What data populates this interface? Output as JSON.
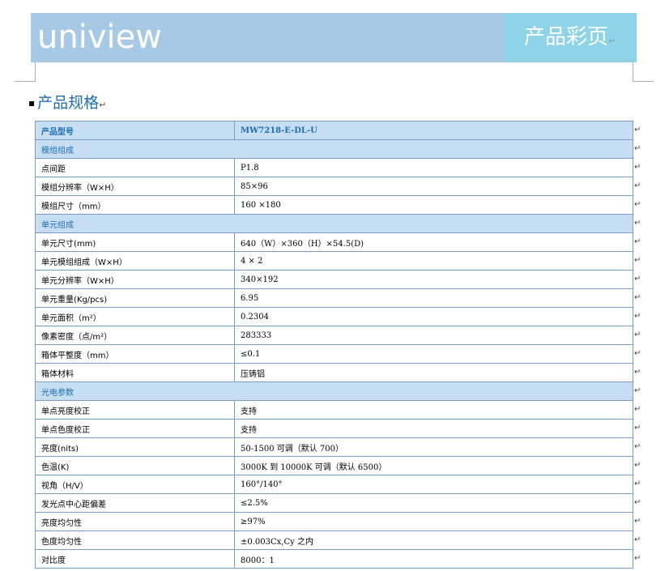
{
  "header": {
    "logo_text": "uniview",
    "brand_title": "产品彩页",
    "colors": {
      "band": "#a7c9e6",
      "band_right": "#8fd4e6",
      "accent": "#1f6fb0"
    }
  },
  "section": {
    "bullet": "▪",
    "title": "产品规格"
  },
  "paragraph_mark": "↵",
  "cell_end_mark": "↵",
  "table": {
    "rows": [
      {
        "type": "head",
        "label": "产品型号",
        "value": "MW7218-E-DL-U"
      },
      {
        "type": "section",
        "label": "模组组成"
      },
      {
        "type": "row",
        "label": "点间距",
        "value": "P1.8"
      },
      {
        "type": "row",
        "label": "模组分辨率（W×H）",
        "value": "85×96"
      },
      {
        "type": "row",
        "label": "模组尺寸（mm）",
        "value": "160 ×180"
      },
      {
        "type": "section",
        "label": "单元组成"
      },
      {
        "type": "row",
        "label": "单元尺寸(mm)",
        "value": "640（W）×360（H）×54.5(D)"
      },
      {
        "type": "row",
        "label": "单元模组组成（W×H）",
        "value": "4 × 2"
      },
      {
        "type": "row",
        "label": "单元分辨率（W×H）",
        "value": "340×192"
      },
      {
        "type": "row",
        "label": "单元重量(Kg/pcs)",
        "value": "6.95"
      },
      {
        "type": "row",
        "label": "单元面积（m²）",
        "value": "0.2304"
      },
      {
        "type": "row",
        "label": "像素密度（点/m²）",
        "value": "283333"
      },
      {
        "type": "row",
        "label": "箱体平整度（mm）",
        "value": "≤0.1"
      },
      {
        "type": "row",
        "label": "箱体材料",
        "value": "压铸铝"
      },
      {
        "type": "section",
        "label": "光电参数"
      },
      {
        "type": "row",
        "label": "单点亮度校正",
        "value": "支持"
      },
      {
        "type": "row",
        "label": "单点色度校正",
        "value": "支持"
      },
      {
        "type": "row",
        "label": "亮度(nits)",
        "value": "50-1500 可调（默认 700）"
      },
      {
        "type": "row",
        "label": "色温(K)",
        "value": "3000K 到 10000K 可调（默认 6500）"
      },
      {
        "type": "row",
        "label": "视角（H/V）",
        "value": "160°/140°"
      },
      {
        "type": "row",
        "label": "发光点中心距偏差",
        "value": "≤2.5%"
      },
      {
        "type": "row",
        "label": "亮度均匀性",
        "value": "≥97%"
      },
      {
        "type": "row",
        "label": "色度均匀性",
        "value": "±0.003Cx,Cy 之内"
      },
      {
        "type": "row",
        "label": "对比度",
        "value": "8000：1"
      }
    ]
  }
}
